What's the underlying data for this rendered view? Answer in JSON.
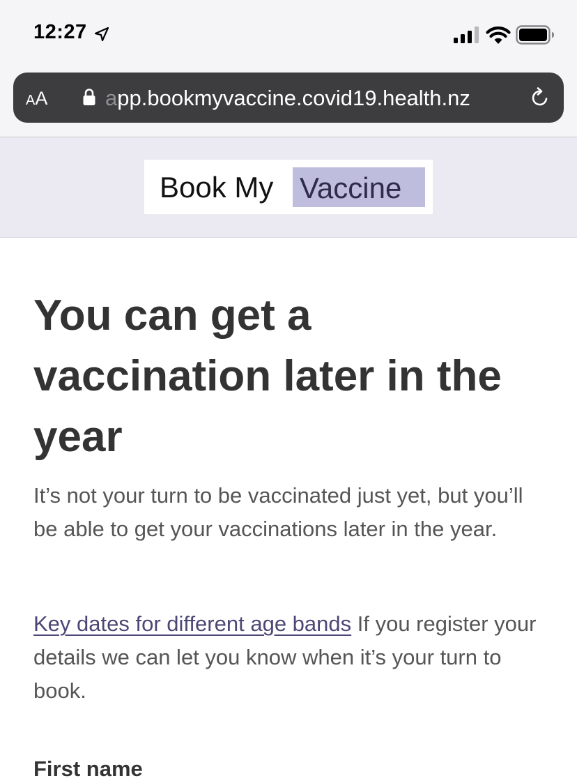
{
  "status_bar": {
    "time": "12:27"
  },
  "browser": {
    "reader_label_small": "A",
    "reader_label_large": "A",
    "url_faded": "a",
    "url_main": "pp.bookmyvaccine.covid19.health.nz"
  },
  "header": {
    "logo_part1": "Book My",
    "logo_part2": "Vaccine",
    "logo_highlight_color": "#bfbddd",
    "background_color": "#ebeaf2"
  },
  "main": {
    "title": "You can get a vaccination later in the year",
    "intro": "It’s not your turn to be vaccinated just yet, but you’ll be able to get your vaccinations later in the year.",
    "key_dates_link": "Key dates for different age bands",
    "register_text": " If you register your details we can let you know when it’s your turn to book.",
    "first_name_label": "First name",
    "link_color": "#4d4776"
  }
}
